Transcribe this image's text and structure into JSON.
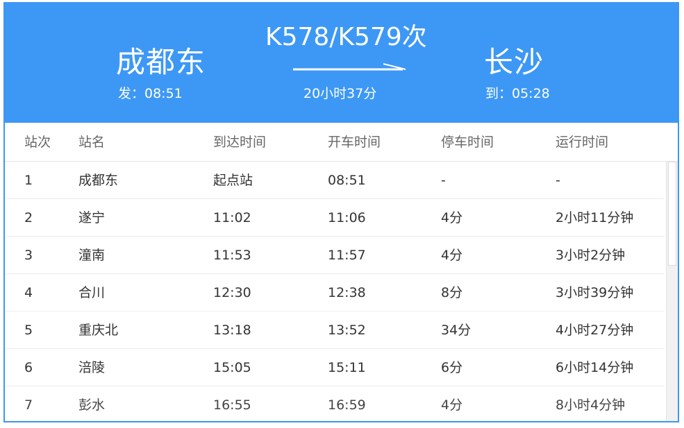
{
  "header": {
    "train_no": "K578/K579次",
    "from_station": "成都东",
    "from_time": "发：08:51",
    "to_station": "长沙",
    "to_time": "到：05:28",
    "duration": "20小时37分"
  },
  "table": {
    "columns": [
      "站次",
      "站名",
      "到达时间",
      "开车时间",
      "停车时间",
      "运行时间"
    ],
    "rows": [
      [
        "1",
        "成都东",
        "起点站",
        "08:51",
        "-",
        "-"
      ],
      [
        "2",
        "遂宁",
        "11:02",
        "11:06",
        "4分",
        "2小时11分钟"
      ],
      [
        "3",
        "潼南",
        "11:53",
        "11:57",
        "4分",
        "3小时2分钟"
      ],
      [
        "4",
        "合川",
        "12:30",
        "12:38",
        "8分",
        "3小时39分钟"
      ],
      [
        "5",
        "重庆北",
        "13:18",
        "13:52",
        "34分",
        "4小时27分钟"
      ],
      [
        "6",
        "涪陵",
        "15:05",
        "15:11",
        "6分",
        "6小时14分钟"
      ],
      [
        "7",
        "彭水",
        "16:55",
        "16:59",
        "4分",
        "8小时4分钟"
      ]
    ]
  },
  "colors": {
    "header_bg": "#3d98f5",
    "header_text": "#ffffff",
    "border": "#3d97f2"
  }
}
